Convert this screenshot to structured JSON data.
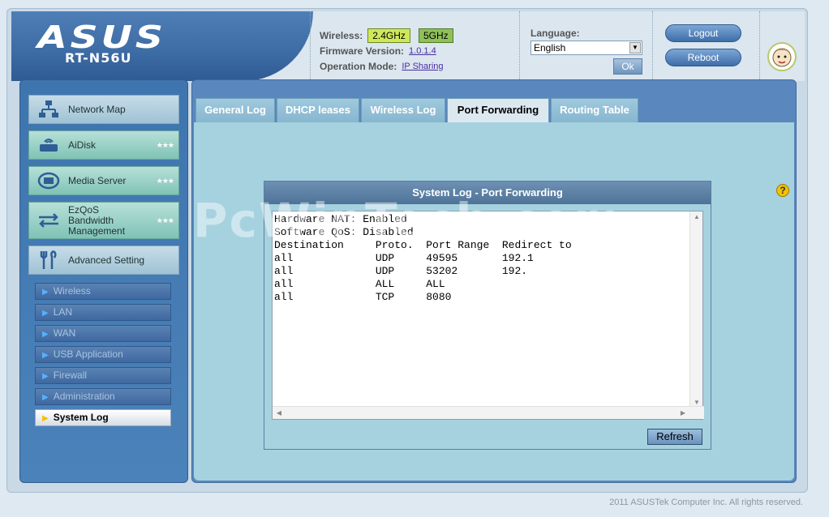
{
  "header": {
    "logo": "ASUS",
    "model": "RT-N56U",
    "wireless_label": "Wireless:",
    "band_24": "2.4GHz",
    "band_5": "5GHz",
    "firmware_label": "Firmware Version:",
    "firmware_value": "1.0.1.4",
    "opmode_label": "Operation Mode:",
    "opmode_value": "IP Sharing",
    "language_label": "Language:",
    "language_value": "English",
    "ok_label": "Ok",
    "logout_label": "Logout",
    "reboot_label": "Reboot"
  },
  "sidebar": {
    "items": [
      {
        "label": "Network Map"
      },
      {
        "label": "AiDisk"
      },
      {
        "label": "Media Server"
      },
      {
        "label": "EzQoS\nBandwidth\nManagement"
      },
      {
        "label": "Advanced Setting"
      }
    ],
    "subitems": [
      {
        "label": "Wireless"
      },
      {
        "label": "LAN"
      },
      {
        "label": "WAN"
      },
      {
        "label": "USB Application"
      },
      {
        "label": "Firewall"
      },
      {
        "label": "Administration"
      },
      {
        "label": "System Log"
      }
    ]
  },
  "tabs": [
    {
      "label": "General Log"
    },
    {
      "label": "DHCP leases"
    },
    {
      "label": "Wireless Log"
    },
    {
      "label": "Port Forwarding"
    },
    {
      "label": "Routing Table"
    }
  ],
  "panel": {
    "title": "System Log - Port Forwarding",
    "log": "Hardware NAT: Enabled\nSoftware QoS: Disabled\nDestination     Proto.  Port Range  Redirect to\nall             UDP     49595       192.1\nall             UDP     53202       192.\nall             ALL     ALL\nall             TCP     8080",
    "refresh_label": "Refresh"
  },
  "footer": "2011 ASUSTek Computer Inc. All rights reserved.",
  "watermark": "PcWinTech.com",
  "colors": {
    "accent": "#3f75ae",
    "content_bg": "#a6d2df",
    "band_24": "#cfe85a",
    "band_5": "#8fc05a"
  }
}
